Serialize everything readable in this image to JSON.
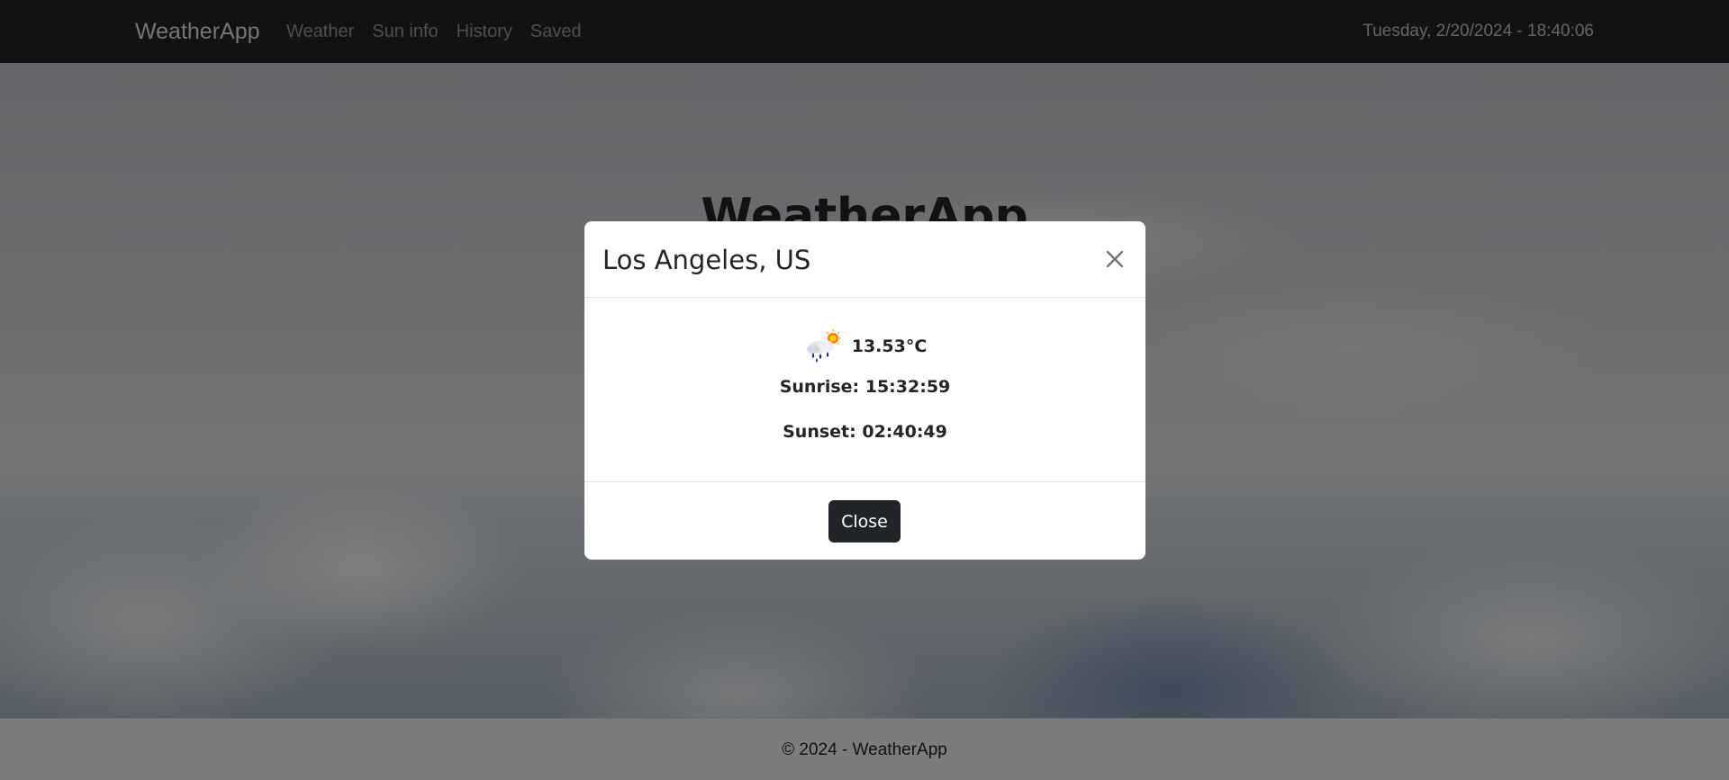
{
  "navbar": {
    "brand": "WeatherApp",
    "links": [
      "Weather",
      "Sun info",
      "History",
      "Saved"
    ],
    "datetime": "Tuesday, 2/20/2024 - 18:40:06"
  },
  "hero": {
    "title": "WeatherApp"
  },
  "footer": {
    "text": "© 2024 - WeatherApp"
  },
  "modal": {
    "title": "Los Angeles, US",
    "weather_icon": "rain-showers-sun-icon",
    "temperature": "13.53°C",
    "sunrise": "Sunrise: 15:32:59",
    "sunset": "Sunset: 02:40:49",
    "close_label": "Close"
  },
  "colors": {
    "navbar_bg": "#212529",
    "button_bg": "#212529",
    "backdrop": "rgba(0,0,0,0.5)"
  }
}
